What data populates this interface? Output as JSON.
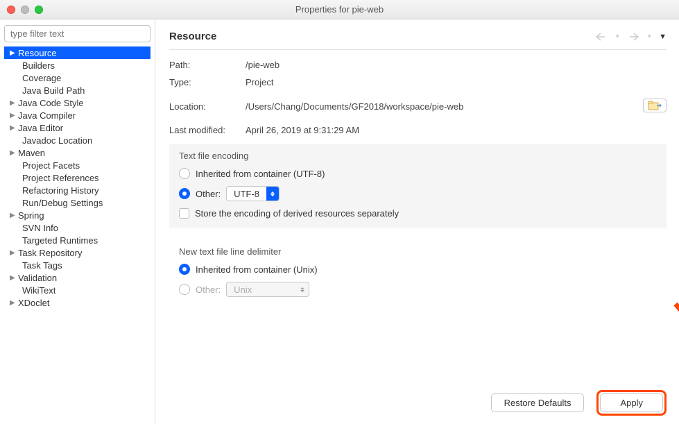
{
  "window": {
    "title": "Properties for pie-web"
  },
  "filter": {
    "placeholder": "type filter text"
  },
  "tree": {
    "items": [
      {
        "label": "Resource",
        "hasChildren": true,
        "selected": true
      },
      {
        "label": "Builders",
        "hasChildren": false,
        "indent": true
      },
      {
        "label": "Coverage",
        "hasChildren": false,
        "indent": true
      },
      {
        "label": "Java Build Path",
        "hasChildren": false,
        "indent": true
      },
      {
        "label": "Java Code Style",
        "hasChildren": true
      },
      {
        "label": "Java Compiler",
        "hasChildren": true
      },
      {
        "label": "Java Editor",
        "hasChildren": true
      },
      {
        "label": "Javadoc Location",
        "hasChildren": false,
        "indent": true
      },
      {
        "label": "Maven",
        "hasChildren": true
      },
      {
        "label": "Project Facets",
        "hasChildren": false,
        "indent": true
      },
      {
        "label": "Project References",
        "hasChildren": false,
        "indent": true
      },
      {
        "label": "Refactoring History",
        "hasChildren": false,
        "indent": true
      },
      {
        "label": "Run/Debug Settings",
        "hasChildren": false,
        "indent": true
      },
      {
        "label": "Spring",
        "hasChildren": true
      },
      {
        "label": "SVN Info",
        "hasChildren": false,
        "indent": true
      },
      {
        "label": "Targeted Runtimes",
        "hasChildren": false,
        "indent": true
      },
      {
        "label": "Task Repository",
        "hasChildren": true
      },
      {
        "label": "Task Tags",
        "hasChildren": false,
        "indent": true
      },
      {
        "label": "Validation",
        "hasChildren": true
      },
      {
        "label": "WikiText",
        "hasChildren": false,
        "indent": true
      },
      {
        "label": "XDoclet",
        "hasChildren": true
      }
    ]
  },
  "page": {
    "title": "Resource",
    "path_label": "Path:",
    "path_value": "/pie-web",
    "type_label": "Type:",
    "type_value": "Project",
    "location_label": "Location:",
    "location_value": "/Users/Chang/Documents/GF2018/workspace/pie-web",
    "modified_label": "Last modified:",
    "modified_value": "April 26, 2019 at 9:31:29 AM"
  },
  "encoding": {
    "group_title": "Text file encoding",
    "inherited_label": "Inherited from container (UTF-8)",
    "other_label": "Other:",
    "other_value": "UTF-8",
    "store_label": "Store the encoding of derived resources separately"
  },
  "delimiter": {
    "group_title": "New text file line delimiter",
    "inherited_label": "Inherited from container (Unix)",
    "other_label": "Other:",
    "other_value": "Unix"
  },
  "buttons": {
    "restore": "Restore Defaults",
    "apply": "Apply"
  }
}
